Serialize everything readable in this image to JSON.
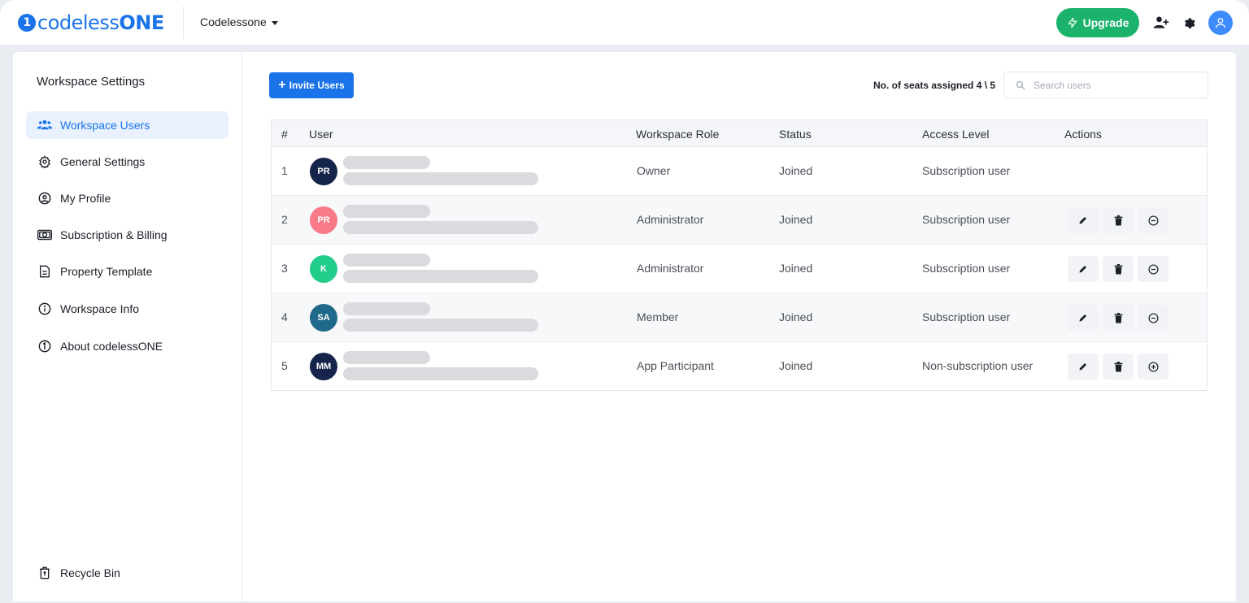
{
  "app": {
    "logo_text": "codeless",
    "logo_one": "ONE",
    "workspace_name": "Codelessone",
    "upgrade_label": "Upgrade"
  },
  "icons": {
    "logo": "codelessone-logo-icon",
    "upgrade": "lightning-icon",
    "add_user": "add-user-icon",
    "settings": "gear-icon",
    "profile": "user-avatar-icon"
  },
  "colors": {
    "primary": "#1a73e8",
    "upgrade": "#1bb36b"
  },
  "sidebar": {
    "title": "Workspace Settings",
    "items": [
      {
        "label": "Workspace Users",
        "icon": "users-icon",
        "active": true
      },
      {
        "label": "General Settings",
        "icon": "gear-icon"
      },
      {
        "label": "My Profile",
        "icon": "user-circle-icon"
      },
      {
        "label": "Subscription & Billing",
        "icon": "money-icon"
      },
      {
        "label": "Property Template",
        "icon": "document-icon"
      },
      {
        "label": "Workspace Info",
        "icon": "info-icon"
      },
      {
        "label": "About codelessONE",
        "icon": "about-logo-icon"
      }
    ],
    "recycle_bin": "Recycle Bin"
  },
  "main": {
    "invite_label": "Invite Users",
    "seats_label": "No. of seats assigned 4 \\ 5",
    "search_placeholder": "Search users",
    "columns": {
      "index": "#",
      "user": "User",
      "role": "Workspace Role",
      "status": "Status",
      "access": "Access Level",
      "actions": "Actions"
    },
    "rows": [
      {
        "index": "1",
        "initials": "PR",
        "avatar_color": "#14244b",
        "role": "Owner",
        "status": "Joined",
        "access": "Subscription user",
        "actions": false
      },
      {
        "index": "2",
        "initials": "PR",
        "avatar_color": "#f77a86",
        "role": "Administrator",
        "status": "Joined",
        "access": "Subscription user",
        "actions": true,
        "toggle": "minus"
      },
      {
        "index": "3",
        "initials": "K",
        "avatar_color": "#22cc8a",
        "role": "Administrator",
        "status": "Joined",
        "access": "Subscription user",
        "actions": true,
        "toggle": "minus"
      },
      {
        "index": "4",
        "initials": "SA",
        "avatar_color": "#1f6a8a",
        "role": "Member",
        "status": "Joined",
        "access": "Subscription user",
        "actions": true,
        "toggle": "minus"
      },
      {
        "index": "5",
        "initials": "MM",
        "avatar_color": "#14244b",
        "role": "App Participant",
        "status": "Joined",
        "access": "Non-subscription user",
        "actions": true,
        "toggle": "plus"
      }
    ]
  }
}
